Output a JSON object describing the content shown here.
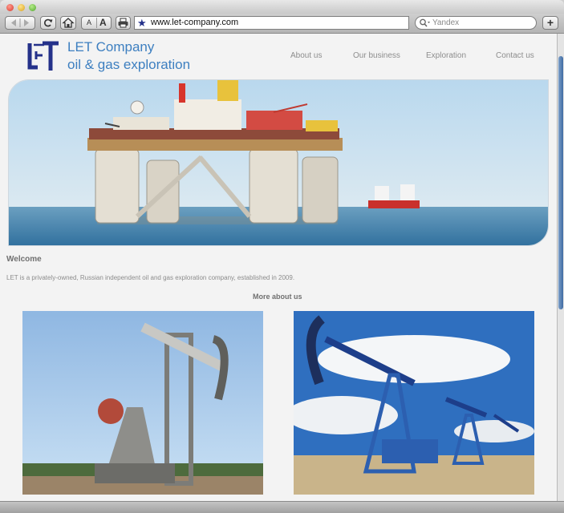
{
  "browser": {
    "url": "www.let-company.com",
    "search_placeholder": "Yandex",
    "font_small_label": "A",
    "font_large_label": "A",
    "new_tab_label": "+"
  },
  "site": {
    "brand_line1": "LET Company",
    "brand_line2": "oil & gas exploration",
    "nav": [
      "About us",
      "Our business",
      "Exploration",
      "Contact us"
    ],
    "welcome_title": "Welcome",
    "description": "LET is a privately-owned, Russian independent oil and gas exploration company, established in 2009.",
    "more_link": "More about us"
  },
  "colors": {
    "brand_blue": "#3d7fc0",
    "logo_blue": "#24318a",
    "page_bg": "#f3f3f3",
    "nav_text": "#8d8d8d"
  },
  "icons": {
    "back": "back-arrow-icon",
    "forward": "forward-arrow-icon",
    "reload": "reload-icon",
    "home": "home-icon",
    "print": "print-icon",
    "bookmark": "star-icon",
    "search": "search-icon"
  }
}
